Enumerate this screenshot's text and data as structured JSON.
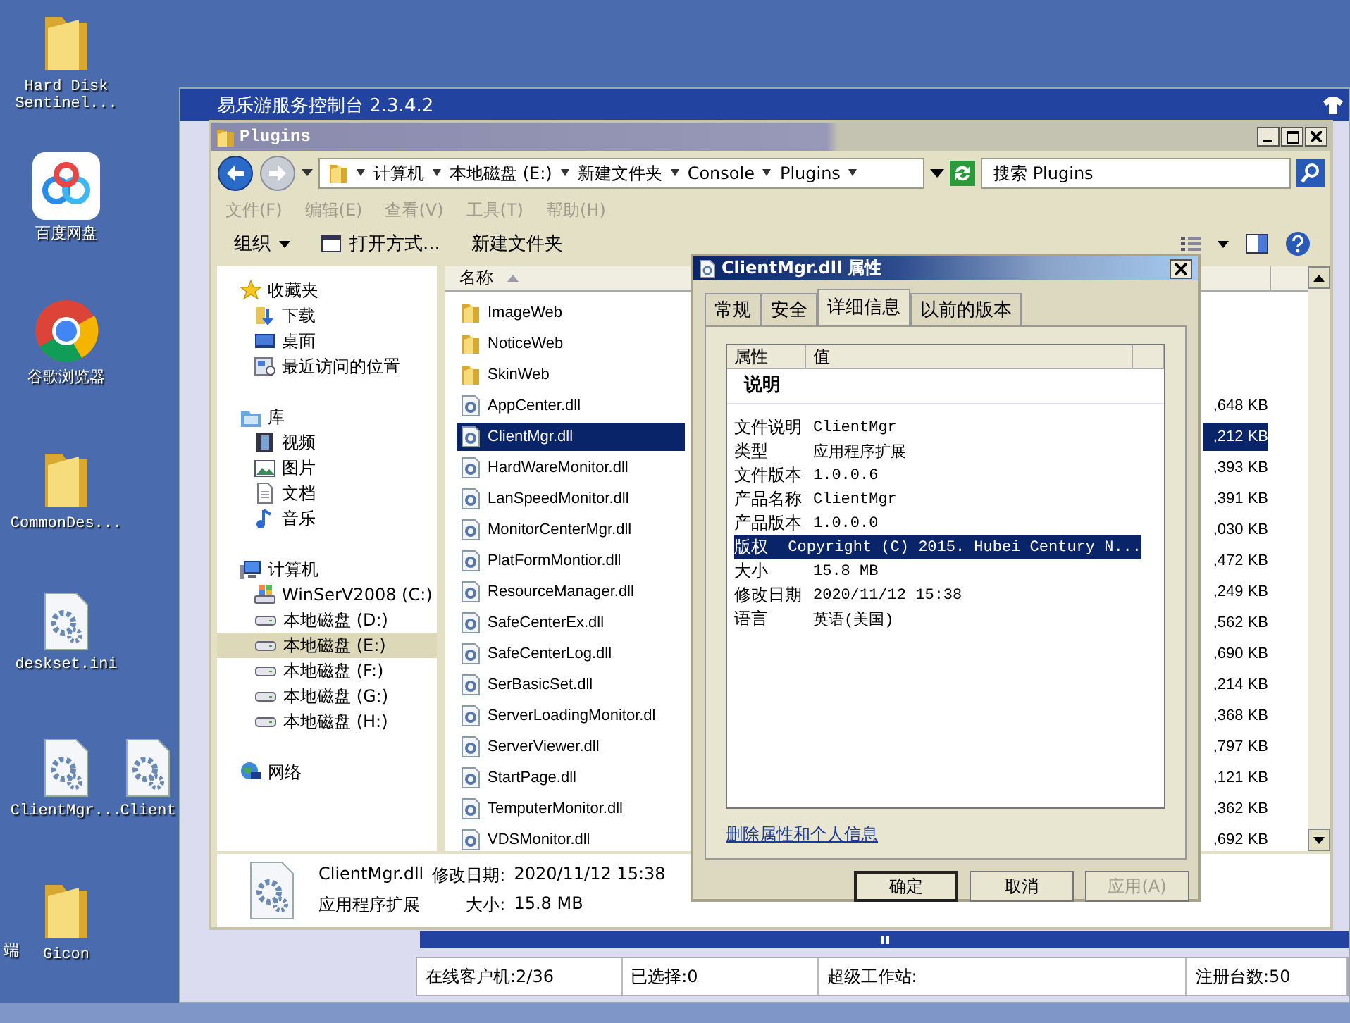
{
  "desktop_icons": [
    {
      "label": "Hard Disk Sentinel...",
      "kind": "folder"
    },
    {
      "label": "百度网盘",
      "kind": "cloud"
    },
    {
      "label": "谷歌浏览器",
      "kind": "browser"
    },
    {
      "label": "CommonDes...",
      "kind": "folder"
    },
    {
      "label": "deskset.ini",
      "kind": "config"
    },
    {
      "label": "ClientMgr...",
      "kind": "config"
    },
    {
      "label": "Client",
      "kind": "config"
    },
    {
      "label": "Gicon",
      "kind": "folder"
    },
    {
      "label": "端",
      "kind": "none"
    }
  ],
  "console_window": {
    "title": "易乐游服务控制台 2.3.4.2",
    "status_bar": [
      "在线客户机:2/36",
      "已选择:0",
      "超级工作站:",
      "注册台数:50"
    ]
  },
  "explorer": {
    "title": "Plugins",
    "breadcrumb": [
      "计算机",
      "本地磁盘 (E:)",
      "新建文件夹",
      "Console",
      "Plugins"
    ],
    "search": {
      "placeholder": "搜索 Plugins"
    },
    "menu": [
      {
        "label": "文件(F)",
        "disabled": true
      },
      {
        "label": "编辑(E)",
        "disabled": true
      },
      {
        "label": "查看(V)",
        "disabled": true
      },
      {
        "label": "工具(T)",
        "disabled": true
      },
      {
        "label": "帮助(H)",
        "disabled": true
      }
    ],
    "toolbar": {
      "organize": "组织",
      "open_with": "打开方式...",
      "new_folder": "新建文件夹"
    },
    "nav": [
      {
        "label": "收藏夹",
        "kind": "star",
        "selected": false,
        "children": [
          {
            "label": "下载",
            "kind": "download",
            "selected": false
          },
          {
            "label": "桌面",
            "kind": "desktop",
            "selected": false
          },
          {
            "label": "最近访问的位置",
            "kind": "recent",
            "selected": false
          }
        ]
      },
      {
        "label": "库",
        "kind": "library",
        "selected": false,
        "children": [
          {
            "label": "视频",
            "kind": "video",
            "selected": false
          },
          {
            "label": "图片",
            "kind": "picture",
            "selected": false
          },
          {
            "label": "文档",
            "kind": "document",
            "selected": false
          },
          {
            "label": "音乐",
            "kind": "music",
            "selected": false
          }
        ]
      },
      {
        "label": "计算机",
        "kind": "computer",
        "selected": false,
        "children": [
          {
            "label": "WinSerV2008 (C:)",
            "kind": "system-drive",
            "selected": false
          },
          {
            "label": "本地磁盘 (D:)",
            "kind": "drive",
            "selected": false
          },
          {
            "label": "本地磁盘 (E:)",
            "kind": "drive",
            "selected": true
          },
          {
            "label": "本地磁盘 (F:)",
            "kind": "drive",
            "selected": false
          },
          {
            "label": "本地磁盘 (G:)",
            "kind": "drive",
            "selected": false
          },
          {
            "label": "本地磁盘 (H:)",
            "kind": "drive",
            "selected": false
          }
        ]
      },
      {
        "label": "网络",
        "kind": "network",
        "selected": false
      }
    ],
    "columns": [
      "名称"
    ],
    "files": [
      {
        "name": "ImageWeb",
        "kind": "folder",
        "selected": false
      },
      {
        "name": "NoticeWeb",
        "kind": "folder",
        "selected": false
      },
      {
        "name": "SkinWeb",
        "kind": "folder",
        "selected": false
      },
      {
        "name": "AppCenter.dll",
        "kind": "dll",
        "size": ",648 KB",
        "selected": false
      },
      {
        "name": "ClientMgr.dll",
        "kind": "dll",
        "size": ",212 KB",
        "selected": true
      },
      {
        "name": "HardWareMonitor.dll",
        "kind": "dll",
        "size": ",393 KB",
        "selected": false
      },
      {
        "name": "LanSpeedMonitor.dll",
        "kind": "dll",
        "size": ",391 KB",
        "selected": false
      },
      {
        "name": "MonitorCenterMgr.dll",
        "kind": "dll",
        "size": ",030 KB",
        "selected": false
      },
      {
        "name": "PlatFormMontior.dll",
        "kind": "dll",
        "size": ",472 KB",
        "selected": false
      },
      {
        "name": "ResourceManager.dll",
        "kind": "dll",
        "size": ",249 KB",
        "selected": false
      },
      {
        "name": "SafeCenterEx.dll",
        "kind": "dll",
        "size": ",562 KB",
        "selected": false
      },
      {
        "name": "SafeCenterLog.dll",
        "kind": "dll",
        "size": ",690 KB",
        "selected": false
      },
      {
        "name": "SerBasicSet.dll",
        "kind": "dll",
        "size": ",214 KB",
        "selected": false
      },
      {
        "name": "ServerLoadingMonitor.dl",
        "kind": "dll",
        "size": ",368 KB",
        "selected": false
      },
      {
        "name": "ServerViewer.dll",
        "kind": "dll",
        "size": ",797 KB",
        "selected": false
      },
      {
        "name": "StartPage.dll",
        "kind": "dll",
        "size": ",121 KB",
        "selected": false
      },
      {
        "name": "TemputerMonitor.dll",
        "kind": "dll",
        "size": ",362 KB",
        "selected": false
      },
      {
        "name": "VDSMonitor.dll",
        "kind": "dll",
        "size": ",692 KB",
        "selected": false
      }
    ],
    "details": {
      "name": "ClientMgr.dll",
      "type": "应用程序扩展",
      "modified_label": "修改日期:",
      "modified": "2020/11/12 15:38",
      "size_label": "大小:",
      "size": "15.8 MB"
    }
  },
  "dialog": {
    "title": "ClientMgr.dll 属性",
    "tabs": [
      {
        "label": "常规",
        "selected": false
      },
      {
        "label": "安全",
        "selected": false
      },
      {
        "label": "详细信息",
        "selected": true
      },
      {
        "label": "以前的版本",
        "selected": false
      }
    ],
    "columns": [
      "属性",
      "值"
    ],
    "section": "说明",
    "properties": [
      {
        "name": "文件说明",
        "value": "ClientMgr",
        "selected": false
      },
      {
        "name": "类型",
        "value": "应用程序扩展",
        "selected": false
      },
      {
        "name": "文件版本",
        "value": "1.0.0.6",
        "selected": false
      },
      {
        "name": "产品名称",
        "value": "ClientMgr",
        "selected": false
      },
      {
        "name": "产品版本",
        "value": "1.0.0.0",
        "selected": false
      },
      {
        "name": "版权",
        "value": "Copyright (C) 2015. Hubei Century N...",
        "selected": true
      },
      {
        "name": "大小",
        "value": "15.8 MB",
        "selected": false
      },
      {
        "name": "修改日期",
        "value": "2020/11/12 15:38",
        "selected": false
      },
      {
        "name": "语言",
        "value": "英语(美国)",
        "selected": false
      }
    ],
    "link": "删除属性和个人信息",
    "buttons": [
      {
        "label": "确定",
        "disabled": false,
        "default": true
      },
      {
        "label": "取消",
        "disabled": false,
        "default": false
      },
      {
        "label": "应用(A)",
        "disabled": true,
        "default": false
      }
    ]
  }
}
